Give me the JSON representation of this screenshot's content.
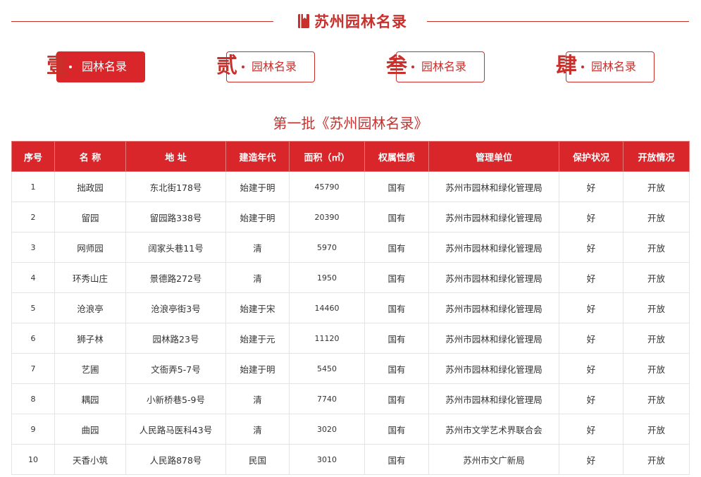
{
  "header": {
    "title": "苏州园林名录",
    "icon": "book-icon",
    "accent_color": "#c8302c"
  },
  "tabs": [
    {
      "numeral": "壹",
      "label": "园林名录",
      "active": true
    },
    {
      "numeral": "贰",
      "label": "园林名录",
      "active": false
    },
    {
      "numeral": "叁",
      "label": "园林名录",
      "active": false
    },
    {
      "numeral": "肆",
      "label": "园林名录",
      "active": false
    }
  ],
  "subtitle": "第一批《苏州园林名录》",
  "table": {
    "header_color": "#d8262a",
    "columns": [
      "序号",
      "名 称",
      "地 址",
      "建造年代",
      "面积（㎡）",
      "权属性质",
      "管理单位",
      "保护状况",
      "开放情况"
    ],
    "rows": [
      [
        "1",
        "拙政园",
        "东北街178号",
        "始建于明",
        "45790",
        "国有",
        "苏州市园林和绿化管理局",
        "好",
        "开放"
      ],
      [
        "2",
        "留园",
        "留园路338号",
        "始建于明",
        "20390",
        "国有",
        "苏州市园林和绿化管理局",
        "好",
        "开放"
      ],
      [
        "3",
        "网师园",
        "阔家头巷11号",
        "清",
        "5970",
        "国有",
        "苏州市园林和绿化管理局",
        "好",
        "开放"
      ],
      [
        "4",
        "环秀山庄",
        "景德路272号",
        "清",
        "1950",
        "国有",
        "苏州市园林和绿化管理局",
        "好",
        "开放"
      ],
      [
        "5",
        "沧浪亭",
        "沧浪亭街3号",
        "始建于宋",
        "14460",
        "国有",
        "苏州市园林和绿化管理局",
        "好",
        "开放"
      ],
      [
        "6",
        "狮子林",
        "园林路23号",
        "始建于元",
        "11120",
        "国有",
        "苏州市园林和绿化管理局",
        "好",
        "开放"
      ],
      [
        "7",
        "艺圃",
        "文衙弄5-7号",
        "始建于明",
        "5450",
        "国有",
        "苏州市园林和绿化管理局",
        "好",
        "开放"
      ],
      [
        "8",
        "耦园",
        "小新桥巷5-9号",
        "清",
        "7740",
        "国有",
        "苏州市园林和绿化管理局",
        "好",
        "开放"
      ],
      [
        "9",
        "曲园",
        "人民路马医科43号",
        "清",
        "3020",
        "国有",
        "苏州市文学艺术界联合会",
        "好",
        "开放"
      ],
      [
        "10",
        "天香小筑",
        "人民路878号",
        "民国",
        "3010",
        "国有",
        "苏州市文广新局",
        "好",
        "开放"
      ]
    ]
  }
}
